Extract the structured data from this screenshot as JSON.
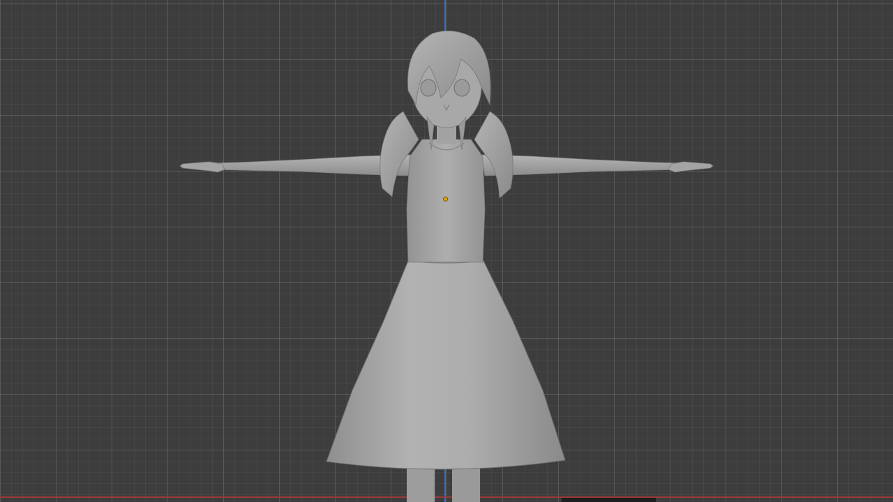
{
  "viewport": {
    "mode": "solid-shading",
    "view": "front-orthographic",
    "background_color": "#3d3d3d",
    "grid_color": "#5a5a5a",
    "axis_colors": {
      "z": "#3a6ec8",
      "x": "#9a3a3a"
    },
    "model_color": "#a9a9a9",
    "origin_color": "#e0a800"
  },
  "scene": {
    "object": "character-model",
    "pose": "t-pose",
    "icon": "origin-point-icon"
  }
}
